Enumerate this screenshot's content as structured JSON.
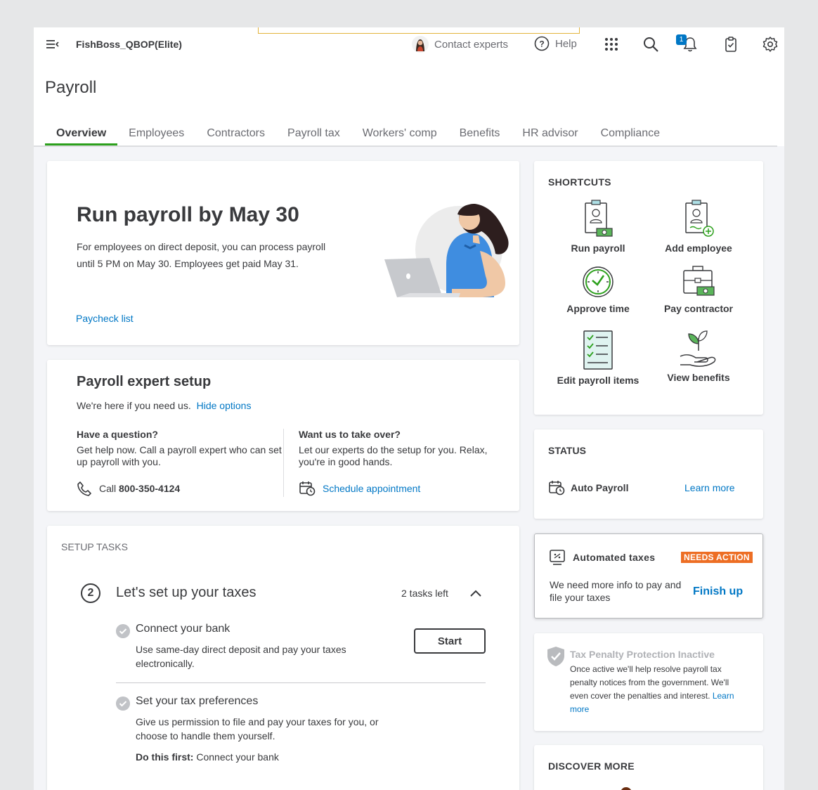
{
  "topbar": {
    "company": "FishBoss_QBOP(Elite)",
    "contact_experts": "Contact experts",
    "help": "Help",
    "notification_count": "1"
  },
  "page": {
    "title": "Payroll",
    "tabs": [
      {
        "label": "Overview",
        "active": true
      },
      {
        "label": "Employees"
      },
      {
        "label": "Contractors"
      },
      {
        "label": "Payroll tax"
      },
      {
        "label": "Workers' comp"
      },
      {
        "label": "Benefits"
      },
      {
        "label": "HR advisor"
      },
      {
        "label": "Compliance"
      }
    ]
  },
  "run_payroll": {
    "title": "Run payroll by May 30",
    "text": "For employees on direct deposit, you can process payroll until 5 PM on May 30. Employees get paid May 31.",
    "link": "Paycheck list"
  },
  "expert_setup": {
    "title": "Payroll expert setup",
    "subtitle": "We're here if you need us.",
    "hide_link": "Hide options",
    "left_heading": "Have a question?",
    "left_text": "Get help now. Call a payroll expert who can set up payroll with you.",
    "call_label": "Call",
    "phone": "800-350-4124",
    "right_heading": "Want us to take over?",
    "right_text": "Let our experts do the setup for you. Relax, you're in good hands.",
    "schedule_link": "Schedule appointment"
  },
  "setup_tasks": {
    "label": "SETUP TASKS",
    "step_number": "2",
    "title": "Let's set up your taxes",
    "tasks_left": "2 tasks left",
    "task1_title": "Connect your bank",
    "task1_desc": "Use same-day direct deposit and pay your taxes electronically.",
    "start_button": "Start",
    "task2_title": "Set your tax preferences",
    "task2_desc": "Give us permission to file and pay your taxes for you, or choose to handle them yourself.",
    "do_first_label": "Do this first:",
    "do_first_value": "Connect your bank"
  },
  "shortcuts": {
    "label": "SHORTCUTS",
    "items": [
      {
        "label": "Run payroll",
        "icon": "run-payroll-icon"
      },
      {
        "label": "Add employee",
        "icon": "add-employee-icon"
      },
      {
        "label": "Approve time",
        "icon": "clock-icon"
      },
      {
        "label": "Pay contractor",
        "icon": "briefcase-icon"
      },
      {
        "label": "Edit payroll items",
        "icon": "checklist-icon"
      },
      {
        "label": "View benefits",
        "icon": "plant-hand-icon"
      }
    ]
  },
  "status": {
    "label": "STATUS",
    "item": "Auto Payroll",
    "learn_more": "Learn more"
  },
  "automated_taxes": {
    "title": "Automated taxes",
    "badge": "NEEDS ACTION",
    "desc": "We need more info to pay and file your taxes",
    "action": "Finish up"
  },
  "tax_penalty": {
    "title": "Tax Penalty Protection Inactive",
    "desc": "Once active we'll help resolve payroll tax penalty notices from the government. We'll even cover the penalties and interest.",
    "learn_more": "Learn more"
  },
  "discover": {
    "label": "DISCOVER MORE"
  },
  "colors": {
    "accent_green": "#2ca01c",
    "link_blue": "#0077c5",
    "needs_action_orange": "#ed6e24"
  }
}
